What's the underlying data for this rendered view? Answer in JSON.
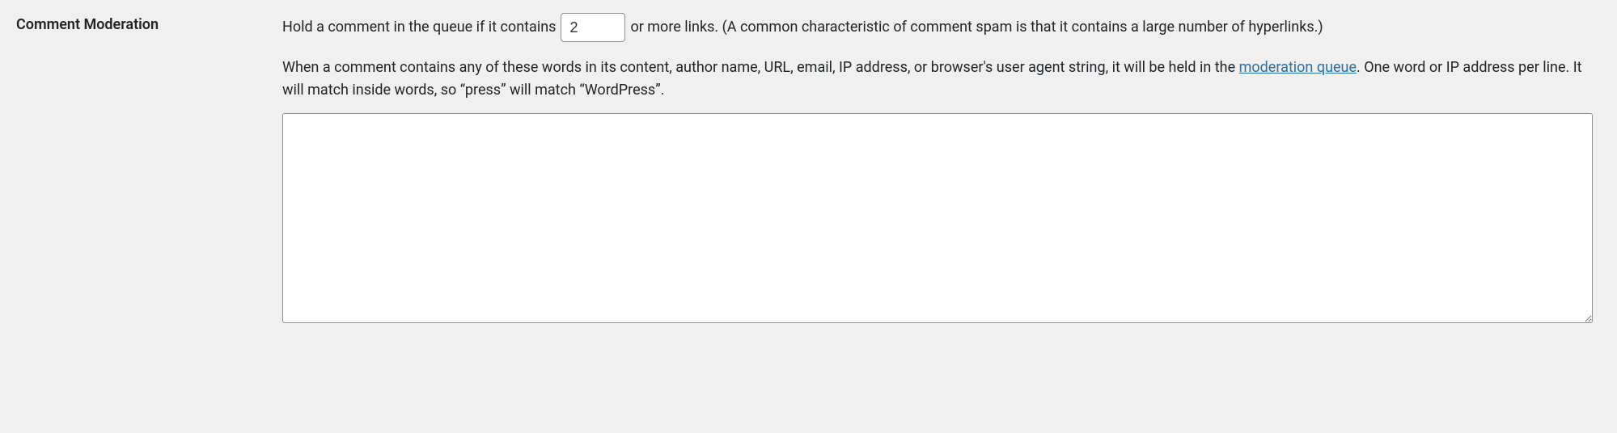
{
  "section": {
    "heading": "Comment Moderation"
  },
  "row1": {
    "before": "Hold a comment in the queue if it contains",
    "value": "2",
    "after": "or more links. (A common characteristic of comment spam is that it contains a large number of hyperlinks.)"
  },
  "desc": {
    "part1": "When a comment contains any of these words in its content, author name, URL, email, IP address, or browser's user agent string, it will be held in the ",
    "link": "moderation queue",
    "part2": ". One word or IP address per line. It will match inside words, so “press” will match “WordPress”."
  },
  "textarea": {
    "value": ""
  }
}
